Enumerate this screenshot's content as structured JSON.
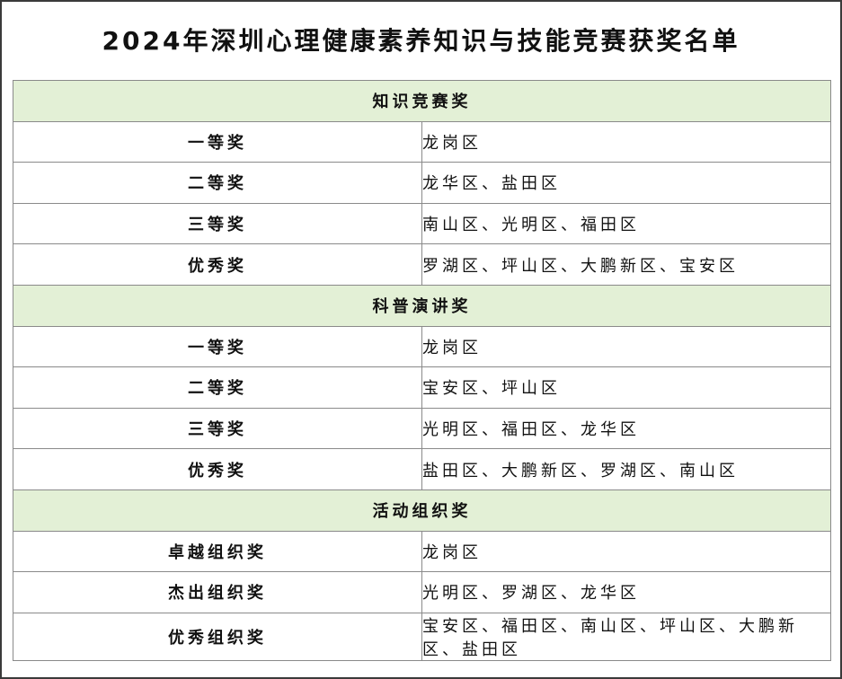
{
  "title": "2024年深圳心理健康素养知识与技能竞赛获奖名单",
  "colors": {
    "section_header_bg": "#e3f0d6",
    "border": "#8a8a8a",
    "frame": "#3a3a3a"
  },
  "sections": [
    {
      "name": "知识竞赛奖",
      "rows": [
        {
          "award": "一等奖",
          "districts": "龙岗区"
        },
        {
          "award": "二等奖",
          "districts": "龙华区、盐田区"
        },
        {
          "award": "三等奖",
          "districts": "南山区、光明区、福田区"
        },
        {
          "award": "优秀奖",
          "districts": "罗湖区、坪山区、大鹏新区、宝安区"
        }
      ]
    },
    {
      "name": "科普演讲奖",
      "rows": [
        {
          "award": "一等奖",
          "districts": "龙岗区"
        },
        {
          "award": "二等奖",
          "districts": "宝安区、坪山区"
        },
        {
          "award": "三等奖",
          "districts": "光明区、福田区、龙华区"
        },
        {
          "award": "优秀奖",
          "districts": "盐田区、大鹏新区、罗湖区、南山区"
        }
      ]
    },
    {
      "name": "活动组织奖",
      "rows": [
        {
          "award": "卓越组织奖",
          "districts": "龙岗区"
        },
        {
          "award": "杰出组织奖",
          "districts": "光明区、罗湖区、龙华区"
        },
        {
          "award": "优秀组织奖",
          "districts": "宝安区、福田区、南山区、坪山区、大鹏新区、盐田区"
        }
      ]
    }
  ]
}
